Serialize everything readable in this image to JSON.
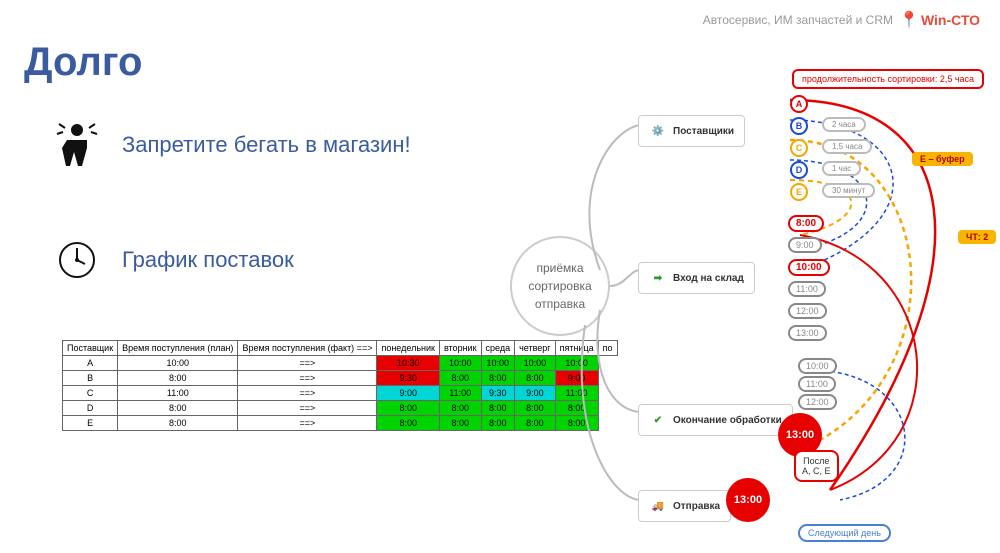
{
  "header": {
    "tagline": "Автосервис, ИМ запчастей и CRM",
    "logo_prefix": "Win-",
    "logo_suffix": "СТО"
  },
  "title": "Долго",
  "bullets": [
    {
      "icon": "person-confused",
      "text": "Запретите бегать в магазин!"
    },
    {
      "icon": "clock",
      "text": "График поставок"
    }
  ],
  "schedule": {
    "headers": [
      "Поставщик",
      "Время поступления (план)",
      "Время поступления (факт) ==>",
      "понедельник",
      "вторник",
      "среда",
      "четверг",
      "пятница",
      "по"
    ],
    "rows": [
      {
        "supplier": "A",
        "plan": "10:00",
        "fact": "==>",
        "cells": [
          {
            "v": "10:30",
            "c": "red"
          },
          {
            "v": "10:00",
            "c": "green"
          },
          {
            "v": "10:00",
            "c": "green"
          },
          {
            "v": "10:00",
            "c": "green"
          },
          {
            "v": "10:00",
            "c": "green"
          }
        ]
      },
      {
        "supplier": "B",
        "plan": "8:00",
        "fact": "==>",
        "cells": [
          {
            "v": "9:30",
            "c": "red"
          },
          {
            "v": "8:00",
            "c": "green"
          },
          {
            "v": "8:00",
            "c": "green"
          },
          {
            "v": "8:00",
            "c": "green"
          },
          {
            "v": "9:00",
            "c": "red"
          }
        ]
      },
      {
        "supplier": "C",
        "plan": "11:00",
        "fact": "==>",
        "cells": [
          {
            "v": "9:00",
            "c": "cyan"
          },
          {
            "v": "11:00",
            "c": "green"
          },
          {
            "v": "9:30",
            "c": "cyan"
          },
          {
            "v": "9:00",
            "c": "cyan"
          },
          {
            "v": "11:00",
            "c": "green"
          }
        ]
      },
      {
        "supplier": "D",
        "plan": "8:00",
        "fact": "==>",
        "cells": [
          {
            "v": "8:00",
            "c": "green"
          },
          {
            "v": "8:00",
            "c": "green"
          },
          {
            "v": "8:00",
            "c": "green"
          },
          {
            "v": "8:00",
            "c": "green"
          },
          {
            "v": "8:00",
            "c": "green"
          }
        ]
      },
      {
        "supplier": "E",
        "plan": "8:00",
        "fact": "==>",
        "cells": [
          {
            "v": "8:00",
            "c": "green"
          },
          {
            "v": "8:00",
            "c": "green"
          },
          {
            "v": "8:00",
            "c": "green"
          },
          {
            "v": "8:00",
            "c": "green"
          },
          {
            "v": "8:00",
            "c": "green"
          }
        ]
      }
    ]
  },
  "mindmap": {
    "center": {
      "line1": "приёмка",
      "line2": "сортировка",
      "line3": "отправка"
    },
    "branches": {
      "suppliers": "Поставщики",
      "entry": "Вход на склад",
      "finish": "Окончание обработки",
      "ship": "Отправка"
    },
    "duration_box": "продолжительность сортировки: 2,5 часа",
    "supplier_nodes": [
      {
        "id": "A",
        "color": "#e60000",
        "label": ""
      },
      {
        "id": "B",
        "color": "#1b4bd6",
        "label": "2 часа"
      },
      {
        "id": "C",
        "color": "#f7a500",
        "label": "1,5 часа"
      },
      {
        "id": "D",
        "color": "#1b4bd6",
        "label": "1 час"
      },
      {
        "id": "E",
        "color": "#f7a500",
        "label": "30 минут"
      }
    ],
    "buffer_badge": "Е – буфер",
    "ch2_badge": "ЧТ: 2",
    "entry_times": [
      "8:00",
      "9:00",
      "10:00",
      "11:00",
      "12:00",
      "13:00"
    ],
    "entry_highlight": [
      "8:00",
      "10:00"
    ],
    "finish_times": [
      "10:00",
      "11:00",
      "12:00"
    ],
    "big_red_finish": "13:00",
    "after_box_line1": "После",
    "after_box_line2": "A, C, E",
    "big_red_ship": "13:00",
    "next_day": "Следующий день"
  }
}
